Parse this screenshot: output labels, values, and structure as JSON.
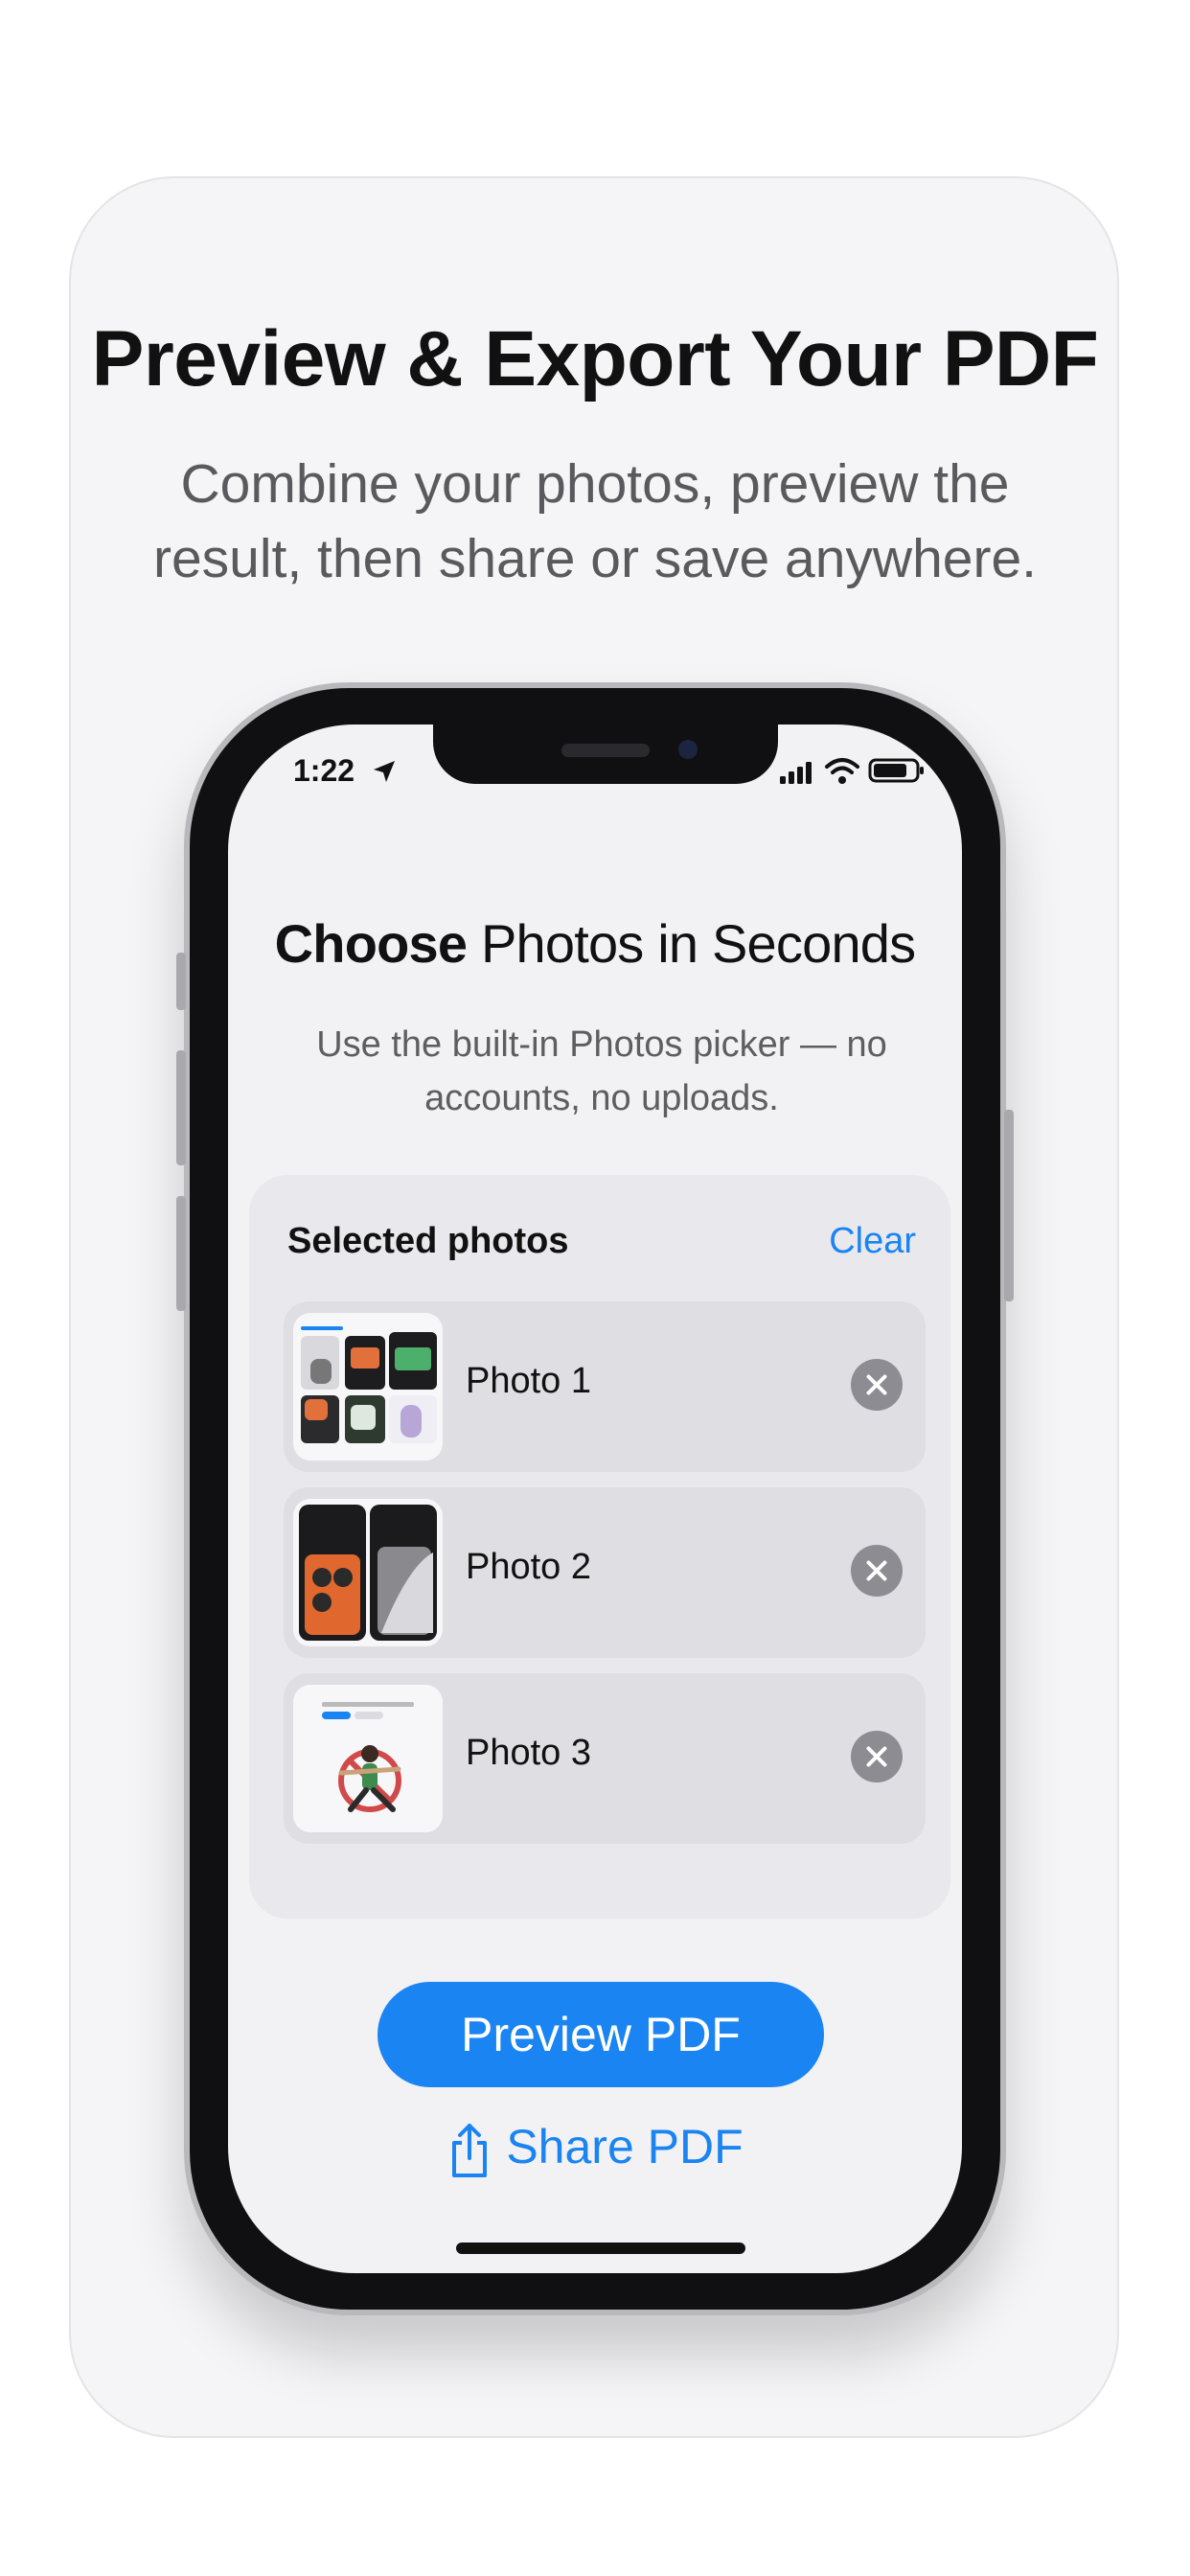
{
  "marketing": {
    "headline": "Preview & Export Your PDF",
    "subline": "Combine your photos, preview the result, then share or save anywhere."
  },
  "status_bar": {
    "time": "1:22",
    "icons": [
      "location-arrow-icon",
      "signal-icon",
      "wifi-icon",
      "battery-icon"
    ]
  },
  "screen": {
    "title_bold": "Choose",
    "title_rest": " Photos in Seconds",
    "subtitle": "Use the built-in Photos picker — no accounts, no uploads."
  },
  "selected_panel": {
    "title": "Selected photos",
    "clear_label": "Clear",
    "items": [
      {
        "label": "Photo 1"
      },
      {
        "label": "Photo 2"
      },
      {
        "label": "Photo 3"
      }
    ]
  },
  "actions": {
    "preview_label": "Preview PDF",
    "share_label": "Share PDF"
  },
  "colors": {
    "accent": "#1a84f2",
    "card_background": "#f5f5f7",
    "remove_button": "#8c8c92"
  }
}
